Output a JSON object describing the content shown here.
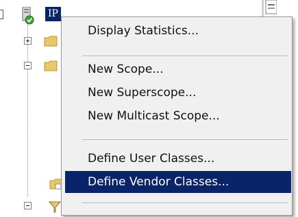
{
  "tree": {
    "server_node_label": "IP",
    "expander_collapsed_symbol": "+",
    "expander_expanded_symbol": "−"
  },
  "context_menu": {
    "items": [
      {
        "label": "Display Statistics..."
      },
      {
        "label": "New Scope..."
      },
      {
        "label": "New Superscope..."
      },
      {
        "label": "New Multicast Scope..."
      },
      {
        "label": "Define User Classes..."
      },
      {
        "label": "Define Vendor Classes..."
      }
    ],
    "highlighted_item": "Define Vendor Classes..."
  },
  "colors": {
    "selection": "#0a246a",
    "menu_background": "#f0f0f0",
    "folder": "#e9c867"
  }
}
